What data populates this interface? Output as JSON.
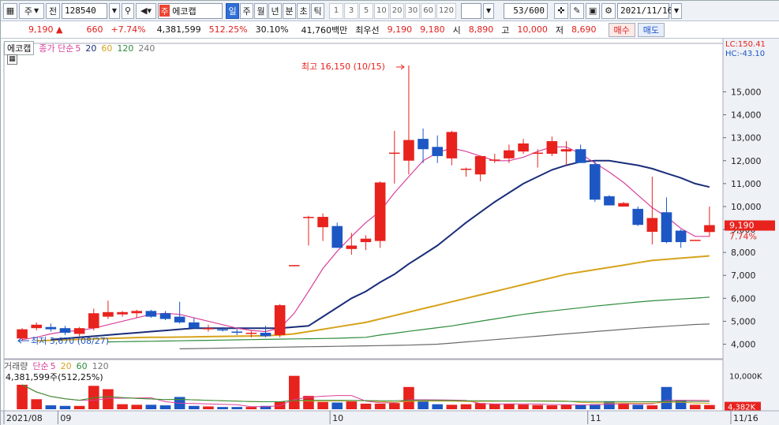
{
  "toolbar": {
    "market_label": "주",
    "prev_label": "전",
    "code": "128540",
    "stock_type_badge": "주",
    "stock_name": "에코캡",
    "period_tabs": [
      "일",
      "주",
      "월",
      "년",
      "분",
      "초",
      "틱"
    ],
    "period_selected": "일",
    "interval_buttons": [
      "1",
      "3",
      "5",
      "10",
      "20",
      "30",
      "60",
      "120"
    ],
    "count": "53/600",
    "date": "2021/11/16"
  },
  "quote": {
    "price": "9,190",
    "up_arrow": "▲",
    "change": "660",
    "change_pct": "+7.74%",
    "volume": "4,381,599",
    "volume_ratio": "512.25%",
    "turnover": "30.10%",
    "amount": "41,760백만",
    "best_ask_label": "최우선",
    "best_ask": "9,190",
    "best_bid": "9,180",
    "open_label": "시",
    "open": "8,890",
    "high_label": "고",
    "high": "10,000",
    "low_label": "저",
    "low": "8,690",
    "buy_label": "매수",
    "sell_label": "매도"
  },
  "chart_legend": {
    "name": "에코캡",
    "indicator": "종가 단순",
    "ma_periods": [
      "5",
      "20",
      "60",
      "120",
      "240"
    ],
    "lc": "LC:150.41",
    "hc": "HC:-43.10",
    "max_annotation": "최고 16,150 (10/15)",
    "min_annotation": "최저 3,670 (08/27)",
    "last_price_tag": "9,190",
    "last_pct_tag": "7.74%"
  },
  "volume_legend": {
    "name": "거래량",
    "indicator": "단순",
    "ma_periods": [
      "5",
      "20",
      "60",
      "120"
    ],
    "last": "4,381,599주(512,25%)",
    "axis_top": "10,000K",
    "last_tag": "4,382K",
    "pct_tag": "512.25%"
  },
  "colors": {
    "up": "#e8221d",
    "down": "#1d57c4",
    "ma5": "#d9409c",
    "ma20": "#1a2d7a",
    "ma60": "#d6a31c",
    "ma120": "#2e8b3c",
    "ma240": "#6b6b6b"
  },
  "chart_data": {
    "type": "candlestick",
    "y_ticks": [
      4000,
      5000,
      6000,
      7000,
      8000,
      9000,
      10000,
      11000,
      12000,
      13000,
      14000,
      15000
    ],
    "ylim": [
      3400,
      16700
    ],
    "x_labels": [
      "2021/08",
      "09",
      "10",
      "11",
      "11/16"
    ],
    "x_label_index": [
      0,
      3,
      22,
      40,
      53
    ],
    "candles": [
      {
        "o": 4250,
        "h": 4700,
        "l": 4150,
        "c": 4650
      },
      {
        "o": 4700,
        "h": 4950,
        "l": 4600,
        "c": 4850
      },
      {
        "o": 4750,
        "h": 4900,
        "l": 4550,
        "c": 4650
      },
      {
        "o": 4700,
        "h": 4800,
        "l": 4400,
        "c": 4500
      },
      {
        "o": 4450,
        "h": 4750,
        "l": 4350,
        "c": 4700
      },
      {
        "o": 4700,
        "h": 5550,
        "l": 4600,
        "c": 5350
      },
      {
        "o": 5200,
        "h": 5900,
        "l": 5100,
        "c": 5400
      },
      {
        "o": 5300,
        "h": 5450,
        "l": 5200,
        "c": 5400
      },
      {
        "o": 5350,
        "h": 5500,
        "l": 5150,
        "c": 5450
      },
      {
        "o": 5450,
        "h": 5500,
        "l": 5150,
        "c": 5200
      },
      {
        "o": 5350,
        "h": 5450,
        "l": 5050,
        "c": 5100
      },
      {
        "o": 5200,
        "h": 5850,
        "l": 4900,
        "c": 4950
      },
      {
        "o": 4950,
        "h": 5150,
        "l": 4700,
        "c": 4700
      },
      {
        "o": 4700,
        "h": 4850,
        "l": 4550,
        "c": 4700
      },
      {
        "o": 4650,
        "h": 4750,
        "l": 4550,
        "c": 4600
      },
      {
        "o": 4550,
        "h": 4650,
        "l": 4400,
        "c": 4500
      },
      {
        "o": 4500,
        "h": 4600,
        "l": 4300,
        "c": 4500
      },
      {
        "o": 4500,
        "h": 4800,
        "l": 4300,
        "c": 4350
      },
      {
        "o": 4400,
        "h": 5750,
        "l": 4300,
        "c": 5700
      },
      {
        "o": 7400,
        "h": 7450,
        "l": 7400,
        "c": 7450
      },
      {
        "o": 9550,
        "h": 9600,
        "l": 8300,
        "c": 9550
      },
      {
        "o": 9100,
        "h": 9700,
        "l": 8500,
        "c": 9550
      },
      {
        "o": 9150,
        "h": 9300,
        "l": 8200,
        "c": 8200
      },
      {
        "o": 8150,
        "h": 8850,
        "l": 7900,
        "c": 8300
      },
      {
        "o": 8450,
        "h": 8750,
        "l": 8100,
        "c": 8600
      },
      {
        "o": 8500,
        "h": 11100,
        "l": 8200,
        "c": 11050
      },
      {
        "o": 12300,
        "h": 13300,
        "l": 11000,
        "c": 12350
      },
      {
        "o": 12000,
        "h": 16150,
        "l": 11400,
        "c": 12900
      },
      {
        "o": 12950,
        "h": 13400,
        "l": 11900,
        "c": 12500
      },
      {
        "o": 12600,
        "h": 13100,
        "l": 11900,
        "c": 12200
      },
      {
        "o": 12100,
        "h": 13300,
        "l": 11800,
        "c": 13250
      },
      {
        "o": 11650,
        "h": 11700,
        "l": 11300,
        "c": 11650
      },
      {
        "o": 11400,
        "h": 12200,
        "l": 11100,
        "c": 12200
      },
      {
        "o": 12000,
        "h": 12300,
        "l": 11900,
        "c": 12050
      },
      {
        "o": 12100,
        "h": 12700,
        "l": 11900,
        "c": 12450
      },
      {
        "o": 12400,
        "h": 12950,
        "l": 12300,
        "c": 12750
      },
      {
        "o": 12350,
        "h": 12500,
        "l": 11700,
        "c": 12350
      },
      {
        "o": 12300,
        "h": 13050,
        "l": 12200,
        "c": 12850
      },
      {
        "o": 12400,
        "h": 12850,
        "l": 11800,
        "c": 12500
      },
      {
        "o": 12500,
        "h": 12700,
        "l": 11900,
        "c": 11900
      },
      {
        "o": 11850,
        "h": 12000,
        "l": 10200,
        "c": 10300
      },
      {
        "o": 10450,
        "h": 10500,
        "l": 10100,
        "c": 10050
      },
      {
        "o": 10000,
        "h": 10200,
        "l": 10000,
        "c": 10150
      },
      {
        "o": 9900,
        "h": 10000,
        "l": 9150,
        "c": 9200
      },
      {
        "o": 8900,
        "h": 11300,
        "l": 8350,
        "c": 9500
      },
      {
        "o": 9750,
        "h": 10400,
        "l": 8400,
        "c": 8450
      },
      {
        "o": 8950,
        "h": 9000,
        "l": 8200,
        "c": 8450
      },
      {
        "o": 8550,
        "h": 8500,
        "l": 8500,
        "c": 8550
      },
      {
        "o": 8890,
        "h": 10000,
        "l": 8690,
        "c": 9190
      }
    ],
    "ma5": [
      4200,
      4300,
      4450,
      4550,
      4600,
      4700,
      4850,
      5000,
      5150,
      5300,
      5350,
      5300,
      5150,
      5000,
      4850,
      4700,
      4600,
      4550,
      4700,
      5350,
      6300,
      7300,
      8050,
      8700,
      9300,
      9800,
      10600,
      11300,
      12000,
      12350,
      12550,
      12400,
      12200,
      12000,
      12000,
      12150,
      12400,
      12600,
      12600,
      12300,
      11900,
      11500,
      11050,
      10500,
      9950,
      9550,
      9050,
      8700,
      8700
    ],
    "ma20": [
      4200,
      4250,
      4300,
      4350,
      4400,
      4450,
      4500,
      4550,
      4600,
      4650,
      4700,
      4700,
      4700,
      4700,
      4700,
      4700,
      4700,
      4750,
      4800,
      5200,
      5600,
      6000,
      6300,
      6700,
      7050,
      7500,
      7900,
      8300,
      8800,
      9300,
      9750,
      10200,
      10600,
      11000,
      11300,
      11600,
      11800,
      11950,
      12000,
      12000,
      11900,
      11800,
      11650,
      11450,
      11250,
      11000,
      10850
    ],
    "ma60": [
      4150,
      4170,
      4190,
      4210,
      4230,
      4250,
      4270,
      4290,
      4300,
      4300,
      4310,
      4320,
      4330,
      4340,
      4350,
      4360,
      4370,
      4400,
      4450,
      4550,
      4650,
      4750,
      4850,
      4950,
      5100,
      5250,
      5400,
      5550,
      5700,
      5850,
      6000,
      6150,
      6300,
      6450,
      6600,
      6750,
      6900,
      7050,
      7150,
      7250,
      7350,
      7450,
      7550,
      7650,
      7700,
      7750,
      7800,
      7850
    ],
    "ma120": [
      4100,
      4110,
      4120,
      4130,
      4140,
      4150,
      4160,
      4170,
      4180,
      4190,
      4200,
      4210,
      4220,
      4230,
      4240,
      4250,
      4260,
      4280,
      4300,
      4400,
      4480,
      4560,
      4640,
      4720,
      4800,
      4900,
      5000,
      5100,
      5200,
      5300,
      5380,
      5450,
      5520,
      5590,
      5660,
      5720,
      5780,
      5840,
      5890,
      5930,
      5970,
      6010,
      6050
    ],
    "ma240": [
      3800,
      3810,
      3820,
      3830,
      3840,
      3850,
      3860,
      3870,
      3880,
      3890,
      3900,
      3910,
      3920,
      3930,
      3940,
      3950,
      3960,
      3980,
      4000,
      4050,
      4100,
      4150,
      4200,
      4250,
      4300,
      4350,
      4400,
      4450,
      4500,
      4550,
      4600,
      4650,
      4700,
      4740,
      4780,
      4820,
      4860,
      4880
    ],
    "volume_k": [
      2200,
      900,
      350,
      300,
      300,
      2100,
      1800,
      450,
      400,
      400,
      350,
      1100,
      300,
      250,
      200,
      200,
      200,
      300,
      700,
      3000,
      1200,
      650,
      600,
      700,
      500,
      500,
      550,
      2000,
      700,
      450,
      400,
      450,
      550,
      500,
      480,
      420,
      380,
      350,
      400,
      400,
      450,
      700,
      500,
      400,
      350,
      2000,
      800,
      400,
      380,
      1000
    ],
    "volume_ylim": [
      0,
      3400
    ]
  }
}
